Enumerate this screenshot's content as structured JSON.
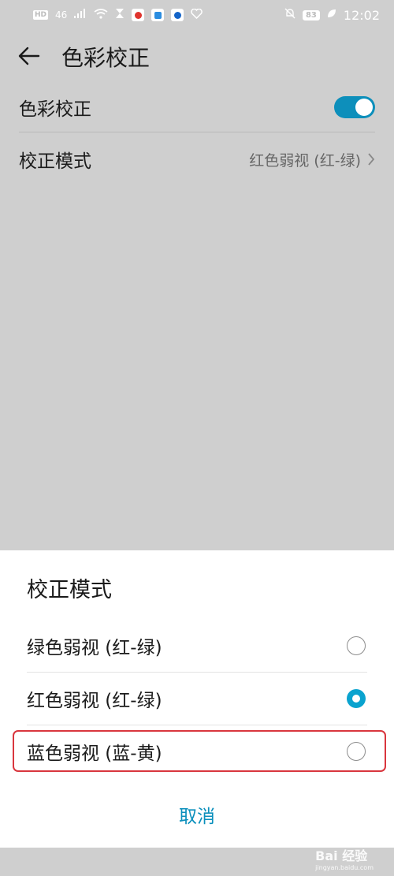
{
  "status_bar": {
    "network_badge": "HD",
    "signal_label": "46",
    "battery_level": "83",
    "time": "12:02"
  },
  "app_bar": {
    "title": "色彩校正"
  },
  "settings": {
    "color_correction_label": "色彩校正",
    "color_correction_enabled": true,
    "correction_mode_label": "校正模式",
    "correction_mode_value": "红色弱视 (红-绿)"
  },
  "dialog": {
    "title": "校正模式",
    "options": [
      {
        "label": "绿色弱视 (红-绿)",
        "selected": false
      },
      {
        "label": "红色弱视 (红-绿)",
        "selected": true
      },
      {
        "label": "蓝色弱视 (蓝-黄)",
        "selected": false
      }
    ],
    "cancel_label": "取消"
  },
  "watermark": {
    "text": "Bai 经验",
    "subtext": "jingyan.baidu.com"
  },
  "colors": {
    "accent": "#0aa3cf",
    "highlight_border": "#d9363e",
    "dim_background": "#cfcfcf"
  }
}
